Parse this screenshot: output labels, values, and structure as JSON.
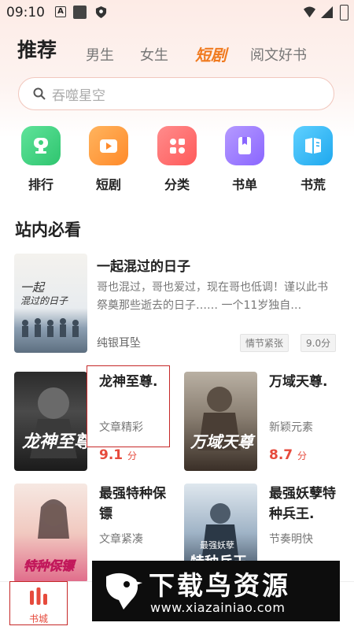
{
  "status": {
    "time": "09:10"
  },
  "tabs": {
    "main": "推荐",
    "items": [
      "男生",
      "女生",
      "短剧",
      "阅文好书"
    ],
    "active_index": 2
  },
  "search": {
    "placeholder": "吞噬星空"
  },
  "categories": [
    {
      "label": "排行",
      "icon": "trophy-icon",
      "color": "#3fd17c"
    },
    {
      "label": "短剧",
      "icon": "play-video-icon",
      "color": "#ff9a3b"
    },
    {
      "label": "分类",
      "icon": "grid-icon",
      "color": "#ff6b6b"
    },
    {
      "label": "书单",
      "icon": "bookmark-book-icon",
      "color": "#9b7bff"
    },
    {
      "label": "书荒",
      "icon": "book-icon",
      "color": "#33b8f5"
    }
  ],
  "section": {
    "title": "站内必看"
  },
  "featured": {
    "title": "一起混过的日子",
    "desc": "哥也混过，哥也爱过，现在哥也低调！谨以此书祭奠那些逝去的日子…… 一个11岁独自…",
    "author": "纯银耳坠",
    "tag": "情节紧张",
    "score": "9.0分"
  },
  "books": [
    {
      "title": "龙神至尊.",
      "sub": "文章精彩",
      "score": "9.1",
      "unit": "分"
    },
    {
      "title": "万域天尊.",
      "sub": "新颖元素",
      "score": "8.7",
      "unit": "分"
    },
    {
      "title": "最强特种保镖",
      "sub": "文章紧凑"
    },
    {
      "title": "最强妖孽特种兵王.",
      "sub": "节奏明快"
    }
  ],
  "bottom": {
    "shelf_label": "书城"
  },
  "watermark": {
    "title": "下载鸟资源",
    "url": "www.xiazainiao.com"
  }
}
